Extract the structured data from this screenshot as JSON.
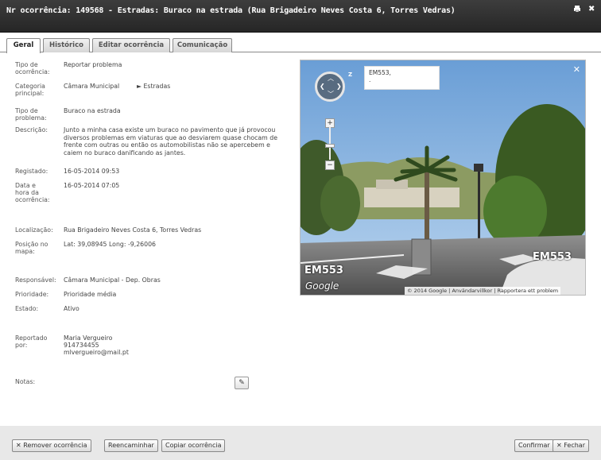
{
  "window": {
    "title": "Nr ocorrência: 149568 - Estradas: Buraco na estrada (Rua Brigadeiro Neves Costa 6, Torres Vedras)",
    "icons": [
      "print-icon",
      "close-icon"
    ]
  },
  "tabs": [
    {
      "label": "Geral",
      "active": true
    },
    {
      "label": "Histórico",
      "active": false
    },
    {
      "label": "Editar ocorrência",
      "active": false
    },
    {
      "label": "Comunicação",
      "active": false
    }
  ],
  "fields": {
    "tipo_ocorrencia": {
      "label": "Tipo de ocorrência:",
      "value": "Reportar problema"
    },
    "categoria": {
      "label": "Categoria principal:",
      "value": "Câmara Municipal",
      "sub": "Estradas"
    },
    "tipo_problema": {
      "label": "Tipo de problema:",
      "value": "Buraco na estrada"
    },
    "descricao": {
      "label": "Descrição:",
      "value": "Junto a minha casa existe um buraco no pavimento que já provocou diversos problemas em viaturas que ao desviarem quase chocam de frente com outras ou então os automobilistas não se apercebem e caiem no buraco danificando as jantes."
    },
    "registado": {
      "label": "Registado:",
      "value": "16-05-2014 09:53"
    },
    "data_ocorrencia": {
      "label": "Data e hora da ocorrência:",
      "value": "16-05-2014 07:05"
    },
    "localizacao": {
      "label": "Localização:",
      "value": "Rua Brigadeiro Neves Costa 6, Torres Vedras"
    },
    "posicao": {
      "label": "Posição no mapa:",
      "value": "Lat: 39,08945 Long: -9,26006"
    },
    "responsavel": {
      "label": "Responsável:",
      "value": "Câmara Municipal - Dep. Obras"
    },
    "prioridade": {
      "label": "Prioridade:",
      "value": "Prioridade média"
    },
    "estado": {
      "label": "Estado:",
      "value": "Ativo"
    },
    "reportado": {
      "label": "Reportado por:",
      "name": "Maria Vergueiro",
      "phone": "914734455",
      "email": "mlvergueiro@mail.pt"
    },
    "notas": {
      "label": "Notas:",
      "value": ""
    }
  },
  "map": {
    "address_box_line1": "EM553,",
    "address_box_line2": ".",
    "road_label_left": "EM553",
    "road_label_right": "EM553",
    "watermark": "Google",
    "copyright": "© 2014 Google",
    "terms": "Användarvillkor",
    "report": "Rapportera ett problem"
  },
  "footer": {
    "remove": "Remover ocorrência",
    "forward": "Reencaminhar",
    "copy": "Copiar ocorrência",
    "confirm": "Confirmar",
    "close": "Fechar"
  },
  "colors": {
    "titlebar": "#2e2e2e",
    "footer": "#e8e8e8"
  }
}
